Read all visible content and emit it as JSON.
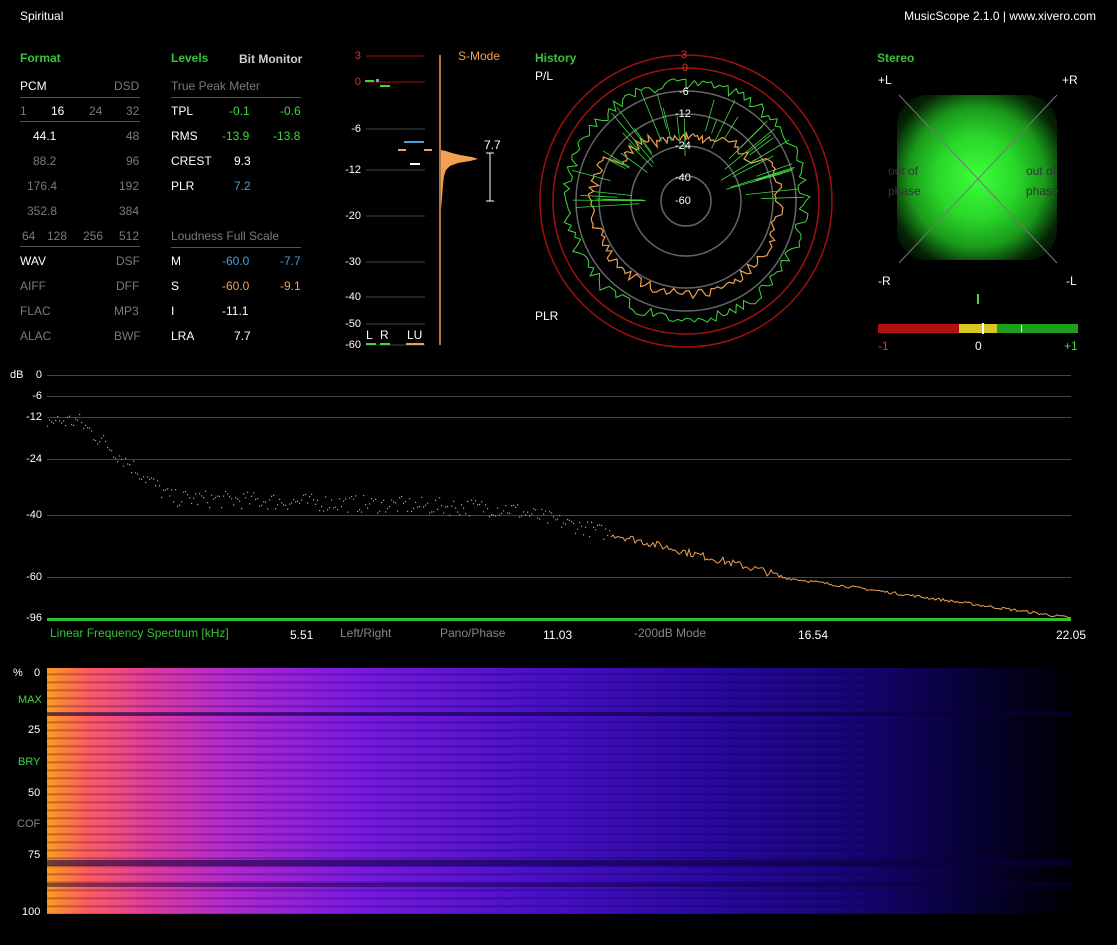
{
  "window": {
    "title": "Spiritual",
    "app_info": "MusicScope 2.1.0 | www.xivero.com"
  },
  "format": {
    "header": "Format",
    "pcm_label": "PCM",
    "dsd_label": "DSD",
    "bits": [
      "1",
      "16",
      "24",
      "32"
    ],
    "rates": [
      {
        "pcm": "44.1",
        "dsd": "48"
      },
      {
        "pcm": "88.2",
        "dsd": "96"
      },
      {
        "pcm": "176.4",
        "dsd": "192"
      },
      {
        "pcm": "352.8",
        "dsd": "384"
      }
    ],
    "dsd_rates": [
      "64",
      "128",
      "256",
      "512"
    ],
    "files": [
      {
        "left": "WAV",
        "right": "DSF"
      },
      {
        "left": "AIFF",
        "right": "DFF"
      },
      {
        "left": "FLAC",
        "right": "MP3"
      },
      {
        "left": "ALAC",
        "right": "BWF"
      }
    ]
  },
  "levels": {
    "header": "Levels",
    "bit_monitor": "Bit Monitor",
    "true_peak_title": "True Peak Meter",
    "rows": [
      {
        "label": "TPL",
        "l": "-0.1",
        "r": "-0.6"
      },
      {
        "label": "RMS",
        "l": "-13.9",
        "r": "-13.8"
      },
      {
        "label": "CREST",
        "l": "9.3",
        "r": ""
      },
      {
        "label": "PLR",
        "l": "7.2",
        "r": ""
      }
    ],
    "loudness_title": "Loudness Full Scale",
    "loudness_rows": [
      {
        "label": "M",
        "a": "-60.0",
        "b": "-7.7"
      },
      {
        "label": "S",
        "a": "-60.0",
        "b": "-9.1"
      },
      {
        "label": "I",
        "a": "-11.1",
        "b": ""
      },
      {
        "label": "LRA",
        "a": "7.7",
        "b": ""
      }
    ]
  },
  "meter": {
    "scale": [
      "3",
      "0",
      "-6",
      "-12",
      "-20",
      "-30",
      "-40",
      "-50",
      "-60"
    ],
    "smode": "S-Mode",
    "lra_value": "7.7",
    "channels": [
      "L",
      "R",
      "LU"
    ]
  },
  "history": {
    "header": "History",
    "pl_label": "P/L",
    "plr_label": "PLR",
    "rings": [
      "3",
      "0",
      "-6",
      "-12",
      "-24",
      "-40",
      "-60"
    ]
  },
  "stereo": {
    "header": "Stereo",
    "corners": {
      "tl": "+L",
      "tr": "+R",
      "bl": "-R",
      "br": "-L"
    },
    "phase_left": [
      "out of",
      "phase"
    ],
    "phase_right": [
      "out of",
      "phase"
    ],
    "correlation": {
      "min": "-1",
      "mid": "0",
      "max": "+1",
      "value": 0.05
    }
  },
  "spectrum": {
    "db_label": "dB",
    "yticks": [
      "0",
      "-6",
      "-12",
      "-24",
      "-40",
      "-60",
      "-96"
    ],
    "axis_label": "Linear Frequency Spectrum [kHz]",
    "xticks": [
      "5.51",
      "11.03",
      "16.54",
      "22.05"
    ],
    "modes": [
      "Left/Right",
      "Pano/Phase",
      "-200dB Mode"
    ]
  },
  "spectrogram": {
    "yticks": [
      "%",
      "0",
      "25",
      "50",
      "75",
      "100"
    ],
    "side_labels": [
      "MAX",
      "BRY",
      "COF"
    ]
  },
  "colors": {
    "accent": "#3bc23b",
    "orange": "#f0a050",
    "blue": "#4a9bd8",
    "red": "#c01818"
  }
}
